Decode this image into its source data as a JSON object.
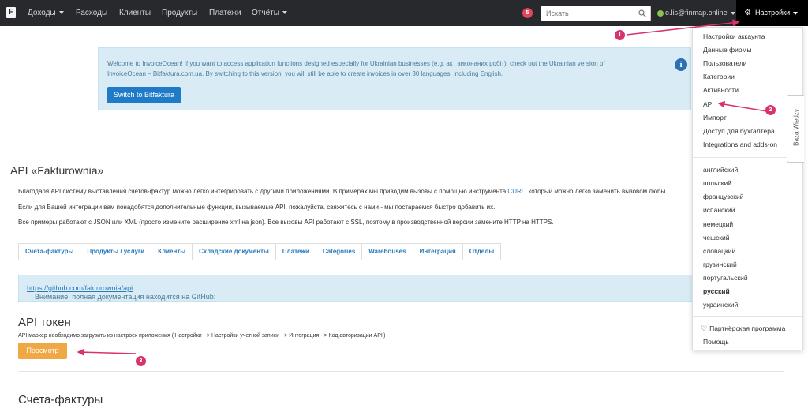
{
  "topnav": {
    "logo": "F",
    "items": [
      "Доходы",
      "Расходы",
      "Клиенты",
      "Продукты",
      "Платежи",
      "Отчёты"
    ],
    "notifications_count": "5",
    "search_placeholder": "Искать",
    "user_email": "o.lis@finmap.online",
    "settings_label": "Настройки"
  },
  "banner": {
    "text": "Welcome to InvoiceOcean! If you want to access application functions designed especially for Ukrainian businesses (e.g. акт виконаних робіт), check out the Ukrainian version of InvoiceOcean – Bitfaktura.com.ua. By switching to this version, you will still be able to create invoices in over 30 languages, including English.",
    "button": "Switch to Bitfaktura"
  },
  "main": {
    "title": "API «Fakturownia»",
    "para1_before": "Благодаря API систему выставления счетов-фактур можно легко интегрировать с другими приложениями. В примерах мы приводим вызовы с помощью инструмента ",
    "para1_link": "CURL",
    "para1_after": ", который можно легко заменить вызовом любы",
    "para2": "Если для Вашей интеграции вам понадобятся дополнительные функции, вызываемые API, пожалуйста, свяжитесь с нами - мы постараемся быстро добавить их.",
    "para3": "Все примеры работают с JSON или XML (просто измените расширение xml на json). Все вызовы API работают с SSL, поэтому в производственной версии замените HTTP на HTTPS.",
    "tabs": [
      "Счета-фактуры",
      "Продукты / услуги",
      "Клиенты",
      "Складские документы",
      "Платежи",
      "Categories",
      "Warehouses",
      "Интеграция",
      "Отделы"
    ],
    "notice_text": "Внимание: полная документация находится на GitHub: ",
    "notice_link": "https://github.com/fakturownia/api",
    "token_title": "API токен",
    "token_desc": "API маркер необходимо загрузить из настроек приложения ('Настройки - > Настройки учетной записи - > Интеграция - > Код авторизации API')",
    "token_button": "Просмотр",
    "invoices_title": "Счета-фактуры"
  },
  "dropdown": {
    "settings_items": [
      "Настройки аккаунта",
      "Данные фирмы",
      "Пользователи",
      "Категории",
      "Активности",
      "API",
      "Импорт",
      "Доступ для бухгалтера",
      "Integrations and adds-on"
    ],
    "languages": [
      "английский",
      "польский",
      "французский",
      "испанский",
      "немецкий",
      "чешский",
      "словацкий",
      "грузинский",
      "португальский",
      "русский",
      "украинский"
    ],
    "active_language": "русский",
    "partner": "Партнёрская программа",
    "help": "Помощь"
  },
  "side_tab": "Baza Wiedzy",
  "annotations": [
    "1",
    "2",
    "3"
  ],
  "colors": {
    "topnav": "#27292c",
    "annotation": "#d8336b",
    "primary_button": "#1f7ac7",
    "warning_button": "#f0a845",
    "info_background": "#d9ecf6"
  }
}
